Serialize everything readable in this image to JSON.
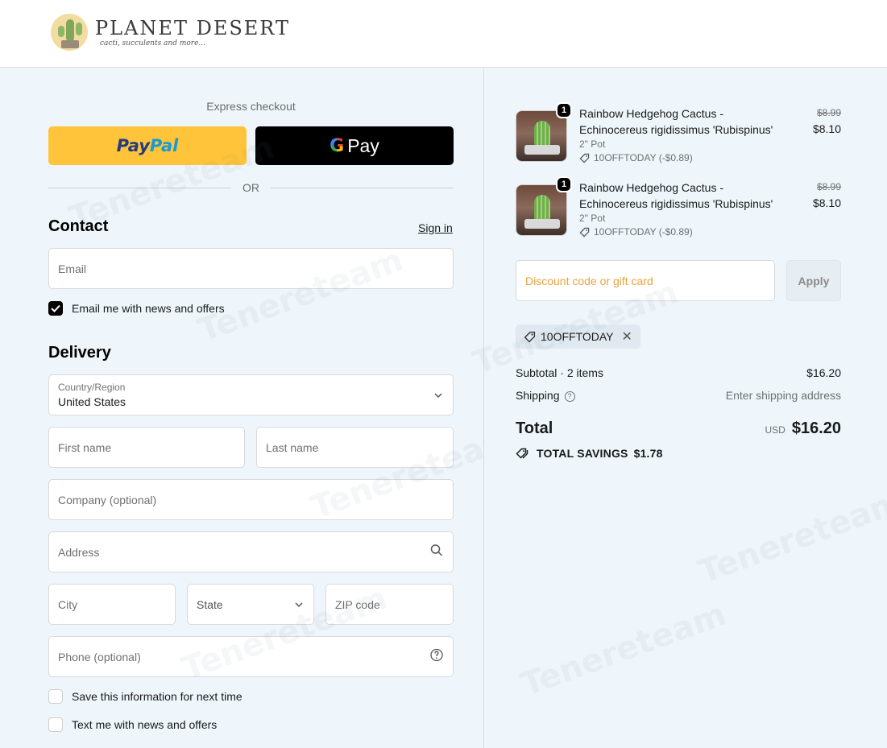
{
  "brand": {
    "name": "PLANET DESERT",
    "tagline": "cacti, succulents and more..."
  },
  "express": {
    "label": "Express checkout",
    "paypal_a": "Pay",
    "paypal_b": "Pal",
    "gpay": "Pay",
    "gpay_g": "G",
    "or": "OR"
  },
  "contact": {
    "title": "Contact",
    "signin": "Sign in",
    "email_placeholder": "Email",
    "news_label": "Email me with news and offers",
    "news_checked": true
  },
  "delivery": {
    "title": "Delivery",
    "country_label": "Country/Region",
    "country_value": "United States",
    "first_name": "First name",
    "last_name": "Last name",
    "company": "Company (optional)",
    "address": "Address",
    "city": "City",
    "state": "State",
    "zip": "ZIP code",
    "phone": "Phone (optional)",
    "save_info": "Save this information for next time",
    "text_news": "Text me with news and offers"
  },
  "cart": {
    "items": [
      {
        "qty": "1",
        "name": "Rainbow Hedgehog Cactus - Echinocereus rigidissimus 'Rubispinus'",
        "variant": "2\" Pot",
        "discount": "10OFFTODAY (-$0.89)",
        "price_old": "$8.99",
        "price_new": "$8.10"
      },
      {
        "qty": "1",
        "name": "Rainbow Hedgehog Cactus - Echinocereus rigidissimus 'Rubispinus'",
        "variant": "2\" Pot",
        "discount": "10OFFTODAY (-$0.89)",
        "price_old": "$8.99",
        "price_new": "$8.10"
      }
    ],
    "discount_placeholder": "Discount code or gift card",
    "apply": "Apply",
    "applied_code": "10OFFTODAY",
    "subtotal_label": "Subtotal · 2 items",
    "subtotal_value": "$16.20",
    "shipping_label": "Shipping",
    "shipping_value": "Enter shipping address",
    "total_label": "Total",
    "currency": "USD",
    "total_value": "$16.20",
    "savings_label": "TOTAL SAVINGS",
    "savings_value": "$1.78"
  },
  "watermark": "Tenereteam",
  "colors": {
    "paypal_bg": "#ffc439",
    "gpay_bg": "#000000",
    "page_bg": "#eef6fb",
    "discount_placeholder": "#e8a33d"
  }
}
